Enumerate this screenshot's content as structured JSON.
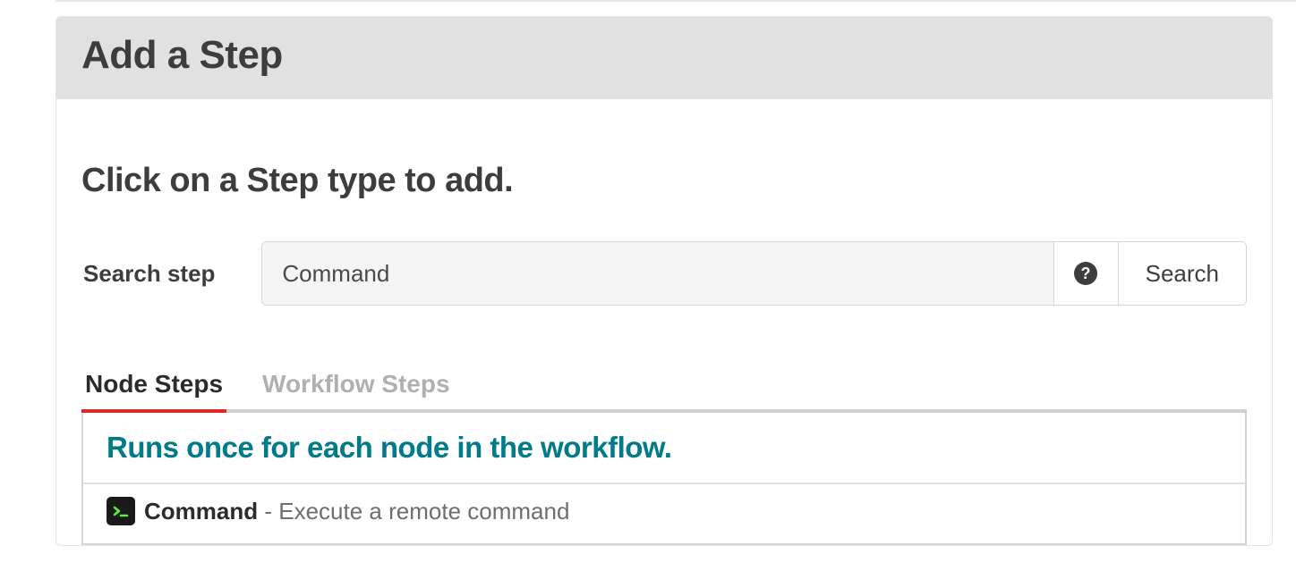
{
  "header": {
    "title": "Add a Step"
  },
  "subtitle": "Click on a Step type to add.",
  "search": {
    "label": "Search step",
    "value": "Command",
    "button": "Search"
  },
  "tabs": [
    {
      "label": "Node Steps",
      "active": true
    },
    {
      "label": "Workflow Steps",
      "active": false
    }
  ],
  "list": {
    "header": "Runs once for each node in the workflow.",
    "items": [
      {
        "name": "Command",
        "description": "Execute a remote command",
        "icon": "terminal-icon"
      }
    ]
  },
  "colors": {
    "accent_red": "#e12626",
    "teal": "#017a8a",
    "header_bg": "#e1e1e1"
  }
}
